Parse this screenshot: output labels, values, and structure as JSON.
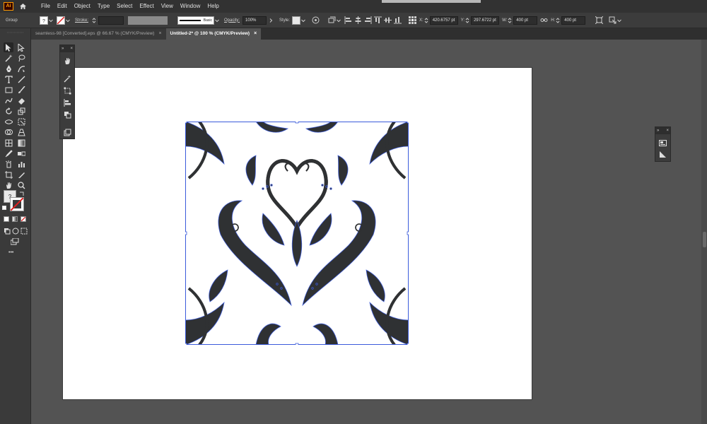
{
  "app": {
    "logo_text": "Ai"
  },
  "menu": [
    "File",
    "Edit",
    "Object",
    "Type",
    "Select",
    "Effect",
    "View",
    "Window",
    "Help"
  ],
  "control_bar": {
    "selection_type": "Group",
    "stroke_label": "Stroke:",
    "brush_label": "Basic",
    "opacity_label": "Opacity:",
    "opacity_value": "100%",
    "style_label": "Style:",
    "x_label": "X:",
    "x_value": "420.6757 pt",
    "y_label": "Y:",
    "y_value": "297.6722 pt",
    "w_label": "W:",
    "w_value": "400 pt",
    "h_label": "H:",
    "h_value": "400 pt"
  },
  "tabs": [
    {
      "label": "seamless-98 [Converted].eps @ 66.67 % (CMYK/Preview)",
      "active": false
    },
    {
      "label": "Untitled-2* @ 100 % (CMYK/Preview)",
      "active": true
    }
  ],
  "tab_close": "×",
  "toolbar": {
    "more_label": "•••",
    "fill_stroke_default": "?"
  },
  "panels": {
    "collapse": "»",
    "close": "×"
  },
  "colors": {
    "ui_bg": "#535353",
    "menubar": "#323232",
    "artboard": "#ffffff",
    "selection": "#3b5bdb",
    "artwork": "#2f3133",
    "logo_accent": "#ff9a00"
  }
}
